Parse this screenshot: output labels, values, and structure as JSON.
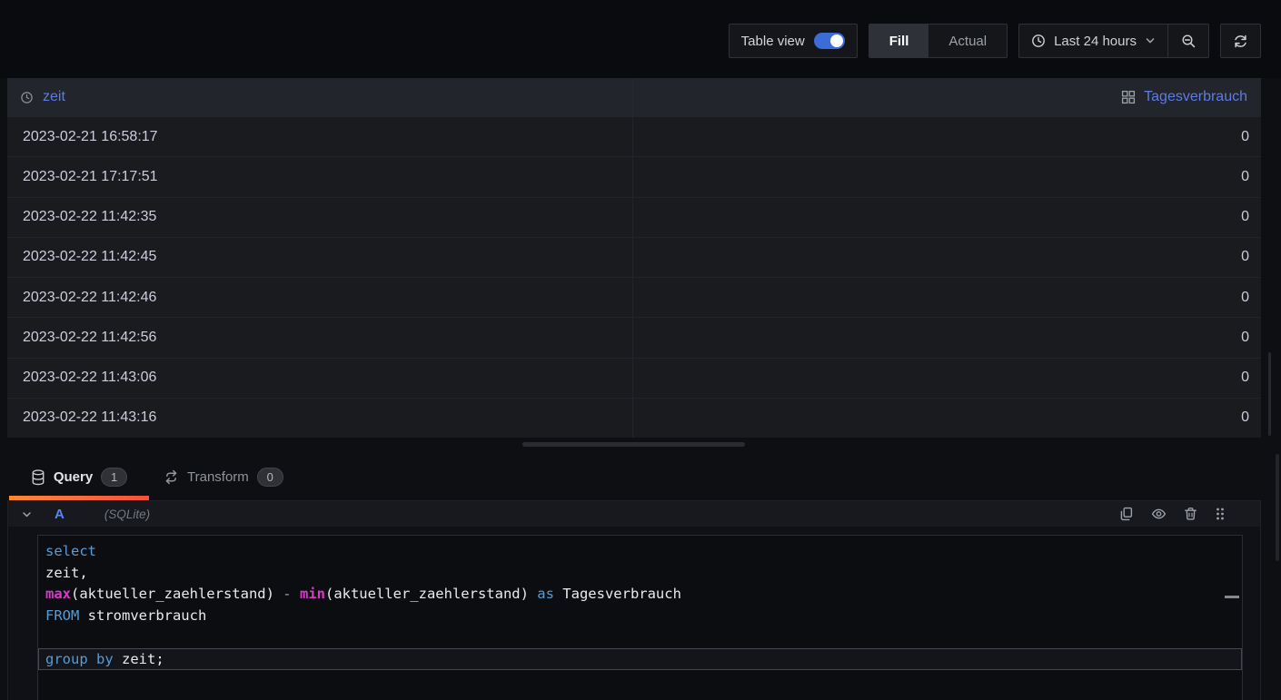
{
  "toolbar": {
    "table_view_label": "Table view",
    "fill_label": "Fill",
    "actual_label": "Actual",
    "time_range_label": "Last 24 hours"
  },
  "table": {
    "col_zeit": "zeit",
    "col_value": "Tagesverbrauch",
    "rows": [
      {
        "zeit": "2023-02-21 16:58:17",
        "value": "0"
      },
      {
        "zeit": "2023-02-21 17:17:51",
        "value": "0"
      },
      {
        "zeit": "2023-02-22 11:42:35",
        "value": "0"
      },
      {
        "zeit": "2023-02-22 11:42:45",
        "value": "0"
      },
      {
        "zeit": "2023-02-22 11:42:46",
        "value": "0"
      },
      {
        "zeit": "2023-02-22 11:42:56",
        "value": "0"
      },
      {
        "zeit": "2023-02-22 11:43:06",
        "value": "0"
      },
      {
        "zeit": "2023-02-22 11:43:16",
        "value": "0"
      }
    ]
  },
  "tabs": {
    "query_label": "Query",
    "query_count": "1",
    "transform_label": "Transform",
    "transform_count": "0"
  },
  "query_row": {
    "ref_id": "A",
    "datasource_hint": "(SQLite)"
  },
  "code": {
    "lines": [
      {
        "tokens": [
          {
            "t": "select",
            "c": "kw"
          }
        ]
      },
      {
        "tokens": [
          {
            "t": "zeit,",
            "c": "pl"
          }
        ]
      },
      {
        "tokens": [
          {
            "t": "max",
            "c": "fn"
          },
          {
            "t": "(aktueller_zaehlerstand) ",
            "c": "pl"
          },
          {
            "t": "-",
            "c": "op"
          },
          {
            "t": " ",
            "c": "pl"
          },
          {
            "t": "min",
            "c": "fn"
          },
          {
            "t": "(aktueller_zaehlerstand) ",
            "c": "pl"
          },
          {
            "t": "as",
            "c": "kw"
          },
          {
            "t": " Tagesverbrauch",
            "c": "pl"
          }
        ]
      },
      {
        "tokens": [
          {
            "t": "FROM",
            "c": "kw"
          },
          {
            "t": " stromverbrauch",
            "c": "pl"
          }
        ]
      },
      {
        "tokens": []
      },
      {
        "tokens": [
          {
            "t": "group by",
            "c": "kw"
          },
          {
            "t": " zeit;",
            "c": "pl"
          }
        ],
        "highlight": true
      }
    ]
  },
  "colors": {
    "toggle_blue": "#3b6cd8",
    "header_link_blue": "#5d7ce2",
    "ref_id_blue": "#5a86f0",
    "tab_underline_start": "#ff8833",
    "tab_underline_end": "#f5503e",
    "code_keyword": "#569cd6",
    "code_function": "#d83bc6",
    "table_header_bg": "#22252b",
    "table_row_bg": "#191b1f"
  }
}
